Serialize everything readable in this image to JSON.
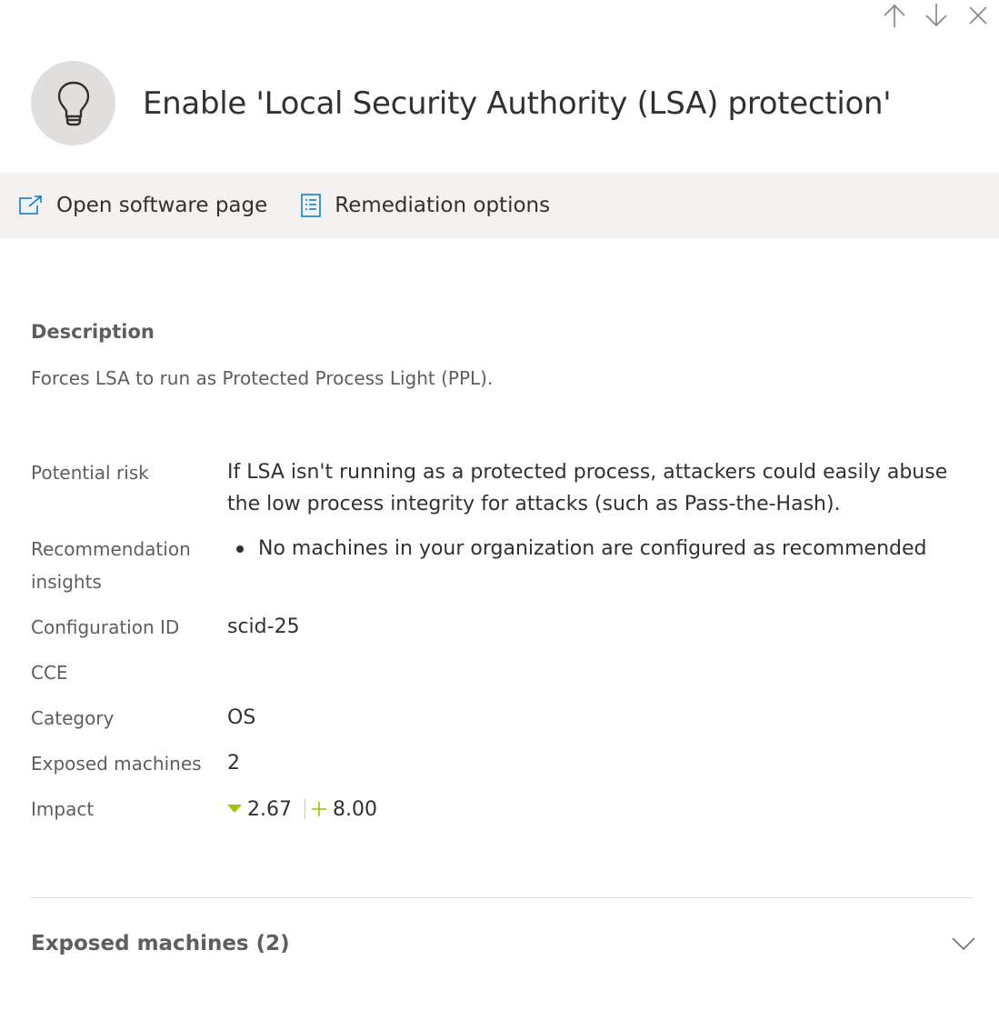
{
  "panel": {
    "title": "Enable 'Local Security Authority (LSA) protection'",
    "icon": "lightbulb-icon"
  },
  "top_actions": [
    {
      "icon": "arrow-up-icon"
    },
    {
      "icon": "arrow-down-icon"
    },
    {
      "icon": "close-icon"
    }
  ],
  "command_bar": {
    "open_software_page": "Open software page",
    "remediation_options": "Remediation options"
  },
  "description": {
    "heading": "Description",
    "text": "Forces LSA to run as Protected Process Light (PPL)."
  },
  "properties": {
    "potential_risk": {
      "label": "Potential risk",
      "value": "If LSA isn't running as a protected process, attackers could easily abuse the low process integrity for attacks (such as Pass-the-Hash)."
    },
    "recommendation_insights": {
      "label": "Recommendation insights",
      "items": [
        "No machines in your organization are configured as recommended"
      ]
    },
    "configuration_id": {
      "label": "Configuration ID",
      "value": "scid-25"
    },
    "cce": {
      "label": "CCE",
      "value": ""
    },
    "category": {
      "label": "Category",
      "value": "OS"
    },
    "exposed_machines": {
      "label": "Exposed machines",
      "value": "2"
    },
    "impact": {
      "label": "Impact",
      "exposure_score": "2.67",
      "secure_score": "8.00"
    }
  },
  "exposed_section": {
    "title": "Exposed machines (2)"
  },
  "colors": {
    "accent": "#0078d4",
    "impact_green": "#a4c400",
    "command_bar_bg": "#f3f2f1",
    "avatar_bg": "#e1dfdd"
  }
}
